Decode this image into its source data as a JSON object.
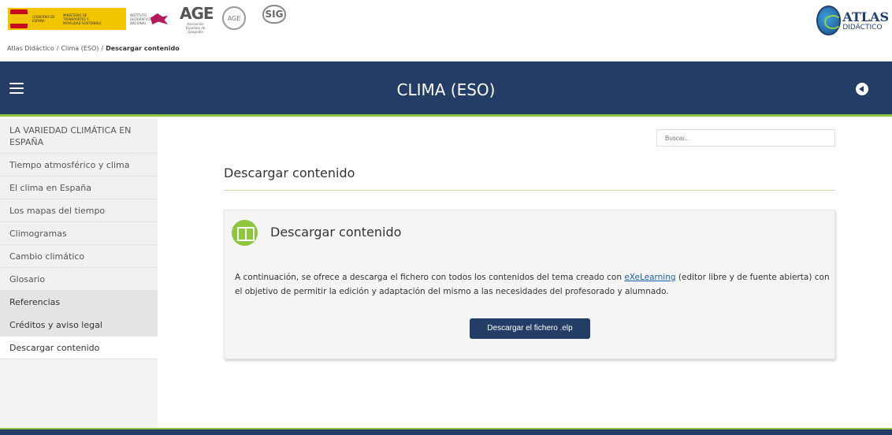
{
  "logos": {
    "gov_text_1": "GOBIERNO DE ESPAÑA",
    "gov_text_2": "MINISTERIO DE TRANSPORTES Y MOVILIDAD SOSTENIBLE",
    "ign_text": "INSTITUTO GEOGRÁFICO NACIONAL",
    "age_big": "AGE",
    "age_small": "Asociación Española de Geografía",
    "age_circle": "AGE",
    "sig_mark": "SIG",
    "atlas_name": "ATLAS",
    "atlas_sub": "DIDÁCTICO"
  },
  "breadcrumb": {
    "item1": "Atlas Didáctico",
    "item2": "Clima (ESO)",
    "current": "Descargar contenido",
    "separator": "/"
  },
  "header": {
    "title": "CLIMA (ESO)"
  },
  "sidebar": {
    "items": [
      {
        "label": "LA VARIEDAD CLIMÁTICA EN ESPAÑA"
      },
      {
        "label": "Tiempo atmosférico y clima"
      },
      {
        "label": "El clima en España"
      },
      {
        "label": "Los mapas del tiempo"
      },
      {
        "label": "Climogramas"
      },
      {
        "label": "Cambio climático"
      },
      {
        "label": "Glosario"
      },
      {
        "label": "Referencias"
      },
      {
        "label": "Créditos y aviso legal"
      },
      {
        "label": "Descargar contenido"
      }
    ]
  },
  "search": {
    "placeholder": "Buscar..."
  },
  "main": {
    "page_title": "Descargar contenido",
    "card_title": "Descargar contenido",
    "text_before_link": "A continuación, se ofrece a descarga el fichero con todos los contenidos del tema creado con ",
    "link_text": "eXeLearning",
    "text_after_link": " (editor libre y de fuente abierta) con el objetivo de permitir la edición y adaptación del mismo a las necesidades del profesorado y alumnado.",
    "download_label": "Descargar el fichero .elp"
  },
  "colors": {
    "header_bg": "#233d66",
    "accent_green": "#8ec63f",
    "link": "#1a5fb4"
  }
}
